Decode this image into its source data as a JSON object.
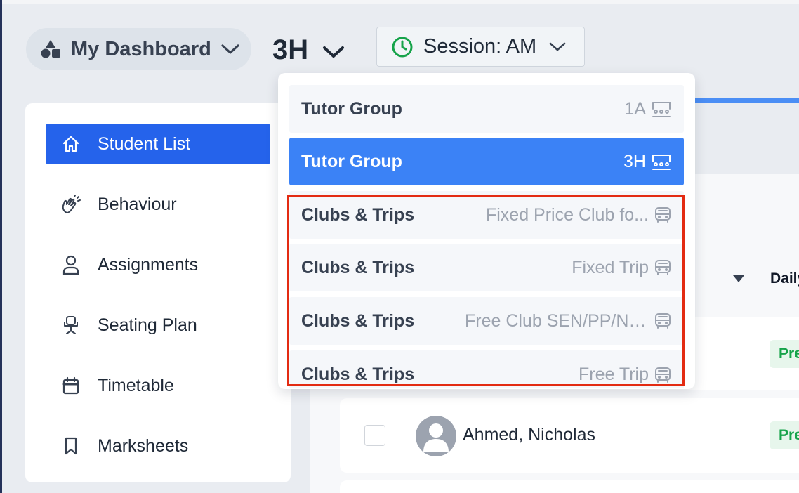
{
  "header": {
    "dashboard_label": "My Dashboard",
    "group_label": "3H",
    "session_label": "Session: AM"
  },
  "sidebar": {
    "items": [
      {
        "label": "Student List",
        "icon": "home-icon",
        "active": true
      },
      {
        "label": "Behaviour",
        "icon": "clapping-hands-icon"
      },
      {
        "label": "Assignments",
        "icon": "user-icon"
      },
      {
        "label": "Seating Plan",
        "icon": "seat-icon"
      },
      {
        "label": "Timetable",
        "icon": "calendar-icon"
      },
      {
        "label": "Marksheets",
        "icon": "bookmark-icon"
      }
    ]
  },
  "dropdown": {
    "items": [
      {
        "type": "Tutor Group",
        "value": "1A",
        "icon": "classroom-icon"
      },
      {
        "type": "Tutor Group",
        "value": "3H",
        "icon": "classroom-icon",
        "selected": true
      },
      {
        "type": "Clubs & Trips",
        "value": "Fixed Price Club fo...",
        "icon": "bus-icon"
      },
      {
        "type": "Clubs & Trips",
        "value": "Fixed Trip",
        "icon": "bus-icon"
      },
      {
        "type": "Clubs & Trips",
        "value": "Free Club SEN/PP/No...",
        "icon": "bus-icon"
      },
      {
        "type": "Clubs & Trips",
        "value": "Free Trip",
        "icon": "bus-icon"
      }
    ]
  },
  "table": {
    "column_daily": "Daily",
    "rows": [
      {
        "name": "",
        "status": "Present"
      },
      {
        "name": "Ahmed, Nicholas",
        "status": "Present"
      }
    ]
  },
  "colors": {
    "primary": "#2563eb",
    "selected_item": "#3b82f6",
    "highlight_border": "#e32b12",
    "present_green": "#16a34a"
  }
}
